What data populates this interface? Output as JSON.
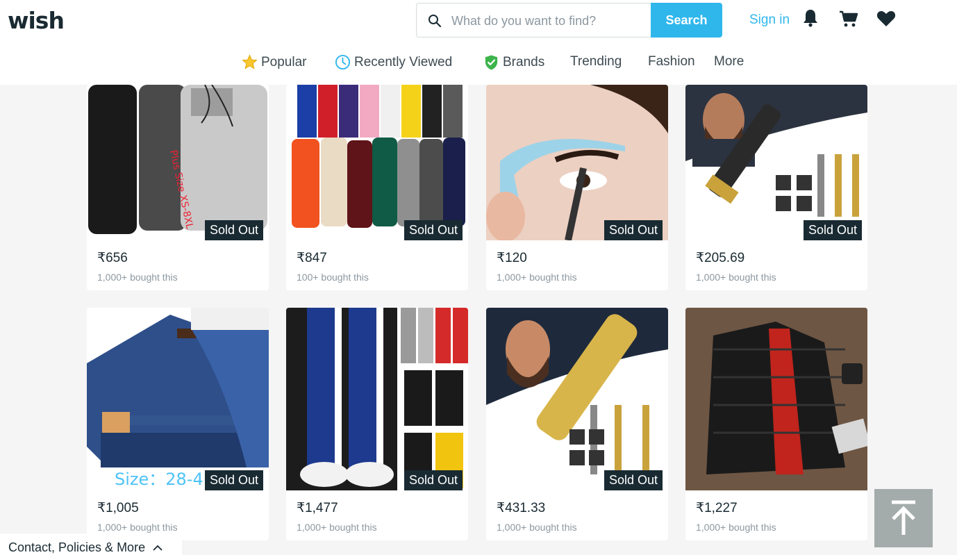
{
  "header": {
    "logo": "wish",
    "search_placeholder": "What do you want to find?",
    "search_label": "Search",
    "signin_label": "Sign in"
  },
  "nav": [
    {
      "label": "Popular",
      "icon": "star-icon"
    },
    {
      "label": "Recently Viewed",
      "icon": "clock-icon"
    },
    {
      "label": "Brands",
      "icon": "shield-check-icon"
    },
    {
      "label": "Trending"
    },
    {
      "label": "Fashion"
    },
    {
      "label": "More"
    }
  ],
  "products": [
    {
      "price": "₹656",
      "bought": "1,000+ bought this",
      "badge": "Sold Out"
    },
    {
      "price": "₹847",
      "bought": "100+ bought this",
      "badge": "Sold Out"
    },
    {
      "price": "₹120",
      "bought": "1,000+ bought this",
      "badge": "Sold Out"
    },
    {
      "price": "₹205.69",
      "bought": "1,000+ bought this",
      "badge": "Sold Out"
    },
    {
      "price": "₹1,005",
      "bought": "1,000+ bought this",
      "badge": "Sold Out",
      "image_text": "Size：28-4"
    },
    {
      "price": "₹1,477",
      "bought": "1,000+ bought this",
      "badge": "Sold Out"
    },
    {
      "price": "₹431.33",
      "bought": "1,000+ bought this",
      "badge": "Sold Out"
    },
    {
      "price": "₹1,227",
      "bought": "1,000+ bought this"
    }
  ],
  "footer": {
    "label": "Contact, Policies & More"
  },
  "colors": {
    "accent": "#2fb7ec",
    "text": "#192a32",
    "muted": "#8c98a0",
    "badge": "#192a32"
  }
}
